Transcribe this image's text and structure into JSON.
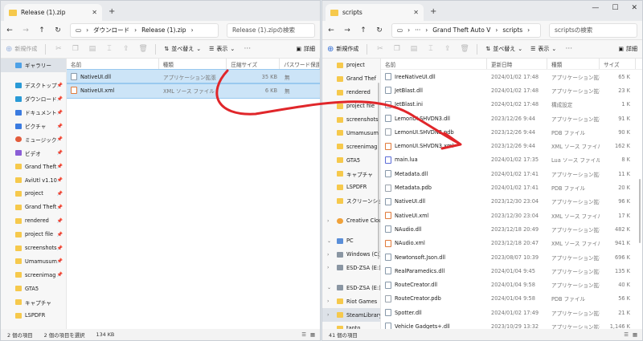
{
  "left": {
    "tab_title": "Release (1).zip",
    "path": [
      "ダウンロード",
      "Release (1).zip"
    ],
    "search_placeholder": "Release (1).zipの検索",
    "new_label": "新規作成",
    "sort_label": "並べ替え",
    "view_label": "表示",
    "details_label": "詳細",
    "sidebar": [
      {
        "label": "ギャラリー",
        "icon": "gallery-icon",
        "pinned": false,
        "selected": true,
        "gap_after": true
      },
      {
        "label": "デスクトップ",
        "icon": "desktop-icon",
        "pinned": true
      },
      {
        "label": "ダウンロード",
        "icon": "download-icon",
        "pinned": true
      },
      {
        "label": "ドキュメント",
        "icon": "document-icon",
        "pinned": true
      },
      {
        "label": "ピクチャ",
        "icon": "picture-icon",
        "pinned": true
      },
      {
        "label": "ミュージック",
        "icon": "music-icon",
        "pinned": true
      },
      {
        "label": "ビデオ",
        "icon": "video-icon",
        "pinned": true
      },
      {
        "label": "Grand Theft",
        "icon": "folder-icon",
        "pinned": true
      },
      {
        "label": "AviUtl v1.10",
        "icon": "folder-icon",
        "pinned": true
      },
      {
        "label": "project",
        "icon": "folder-icon",
        "pinned": true
      },
      {
        "label": "Grand Theft",
        "icon": "folder-icon",
        "pinned": true
      },
      {
        "label": "rendered",
        "icon": "folder-icon",
        "pinned": true
      },
      {
        "label": "project file",
        "icon": "folder-icon",
        "pinned": true
      },
      {
        "label": "screenshots",
        "icon": "folder-icon",
        "pinned": true
      },
      {
        "label": "Umamusum",
        "icon": "folder-icon",
        "pinned": true
      },
      {
        "label": "screenimag",
        "icon": "folder-icon",
        "pinned": true
      },
      {
        "label": "GTA5",
        "icon": "folder-icon",
        "pinned": false
      },
      {
        "label": "キャプチャ",
        "icon": "folder-icon",
        "pinned": false
      },
      {
        "label": "LSPDFR",
        "icon": "folder-icon",
        "pinned": false
      }
    ],
    "columns": [
      "名前",
      "種類",
      "圧縮サイズ",
      "パスワード保護"
    ],
    "files": [
      {
        "name": "NativeUI.dll",
        "type": "アプリケーション拡張",
        "size": "35 KB",
        "password": "無",
        "icon": "dll"
      },
      {
        "name": "NativeUI.xml",
        "type": "XML ソース ファイル",
        "size": "6 KB",
        "password": "無",
        "icon": "xml"
      }
    ],
    "status": [
      "2 個の項目",
      "2 個の項目を選択",
      "134 KB"
    ]
  },
  "right": {
    "tab_title": "scripts",
    "path": [
      "Grand Theft Auto V",
      "scripts"
    ],
    "search_placeholder": "scriptsの検索",
    "new_label": "新規作成",
    "sort_label": "並べ替え",
    "view_label": "表示",
    "details_label": "詳細",
    "sidebar": [
      {
        "label": "project",
        "icon": "folder-icon"
      },
      {
        "label": "Grand Thef",
        "icon": "folder-icon"
      },
      {
        "label": "rendered",
        "icon": "folder-icon"
      },
      {
        "label": "project file",
        "icon": "folder-icon"
      },
      {
        "label": "screenshots",
        "icon": "folder-icon"
      },
      {
        "label": "Umamusum",
        "icon": "folder-icon"
      },
      {
        "label": "screenimag",
        "icon": "folder-icon"
      },
      {
        "label": "GTA5",
        "icon": "folder-icon"
      },
      {
        "label": "キャプチャ",
        "icon": "folder-icon"
      },
      {
        "label": "LSPDFR",
        "icon": "folder-icon"
      },
      {
        "label": "スクリーンショット",
        "icon": "folder-icon",
        "gap_after": true
      },
      {
        "label": "Creative Cloud",
        "icon": "cloud-icon",
        "chevron": true,
        "gap_after": true
      },
      {
        "label": "PC",
        "icon": "pc-icon",
        "chevron": true,
        "expanded": true
      },
      {
        "label": "Windows (C:)",
        "icon": "drive-icon",
        "chevron": true
      },
      {
        "label": "ESD-ZSA (E:)",
        "icon": "drive-icon",
        "chevron": true,
        "gap_after": true
      },
      {
        "label": "ESD-ZSA (E:)",
        "icon": "drive-icon",
        "chevron": true,
        "expanded": true
      },
      {
        "label": "Riot Games",
        "icon": "folder-icon",
        "chevron": true
      },
      {
        "label": "SteamLibrary",
        "icon": "folder-icon",
        "chevron": true,
        "selected": true
      },
      {
        "label": "tanto",
        "icon": "folder-icon"
      }
    ],
    "columns": [
      "名前",
      "更新日時",
      "種類",
      "サイズ"
    ],
    "files": [
      {
        "name": "IreeNativeUI.dll",
        "date": "2024/01/02 17:48",
        "type": "アプリケーション拡張",
        "size": "65 K",
        "icon": "dll"
      },
      {
        "name": "JetBlast.dll",
        "date": "2024/01/02 17:48",
        "type": "アプリケーション拡張",
        "size": "23 K",
        "icon": "dll"
      },
      {
        "name": "JetBlast.ini",
        "date": "2024/01/02 17:48",
        "type": "構成設定",
        "size": "1 K",
        "icon": "dll"
      },
      {
        "name": "LemonUI.SHVDN3.dll",
        "date": "2023/12/26 9:44",
        "type": "アプリケーション拡張",
        "size": "91 K",
        "icon": "dll"
      },
      {
        "name": "LemonUI.SHVDN3.pdb",
        "date": "2023/12/26 9:44",
        "type": "PDB ファイル",
        "size": "90 K",
        "icon": "pdb"
      },
      {
        "name": "LemonUI.SHVDN3.xml",
        "date": "2023/12/26 9:44",
        "type": "XML ソース ファイル",
        "size": "162 K",
        "icon": "xml"
      },
      {
        "name": "main.lua",
        "date": "2024/01/02 17:35",
        "type": "Lua ソース ファイル",
        "size": "8 K",
        "icon": "lua"
      },
      {
        "name": "Metadata.dll",
        "date": "2024/01/02 17:41",
        "type": "アプリケーション拡張",
        "size": "11 K",
        "icon": "dll"
      },
      {
        "name": "Metadata.pdb",
        "date": "2024/01/02 17:41",
        "type": "PDB ファイル",
        "size": "20 K",
        "icon": "pdb"
      },
      {
        "name": "NativeUI.dll",
        "date": "2023/12/30 23:04",
        "type": "アプリケーション拡張",
        "size": "96 K",
        "icon": "dll"
      },
      {
        "name": "NativeUI.xml",
        "date": "2023/12/30 23:04",
        "type": "XML ソース ファイル",
        "size": "17 K",
        "icon": "xml"
      },
      {
        "name": "NAudio.dll",
        "date": "2023/12/18 20:49",
        "type": "アプリケーション拡張",
        "size": "482 K",
        "icon": "dll"
      },
      {
        "name": "NAudio.xml",
        "date": "2023/12/18 20:47",
        "type": "XML ソース ファイル",
        "size": "941 K",
        "icon": "xml"
      },
      {
        "name": "Newtonsoft.Json.dll",
        "date": "2023/08/07 10:39",
        "type": "アプリケーション拡張",
        "size": "696 K",
        "icon": "dll"
      },
      {
        "name": "RealParamedics.dll",
        "date": "2024/01/04 9:45",
        "type": "アプリケーション拡張",
        "size": "135 K",
        "icon": "dll"
      },
      {
        "name": "RouteCreator.dll",
        "date": "2024/01/04 9:58",
        "type": "アプリケーション拡張",
        "size": "40 K",
        "icon": "dll"
      },
      {
        "name": "RouteCreator.pdb",
        "date": "2024/01/04 9:58",
        "type": "PDB ファイル",
        "size": "56 K",
        "icon": "pdb"
      },
      {
        "name": "Spotter.dll",
        "date": "2024/01/02 17:49",
        "type": "アプリケーション拡張",
        "size": "21 K",
        "icon": "dll"
      },
      {
        "name": "Vehicle Gadgets+.dll",
        "date": "2023/10/29 13:32",
        "type": "アプリケーション拡張",
        "size": "1,146 K",
        "icon": "dll"
      }
    ],
    "status": [
      "41 個の項目"
    ]
  },
  "colors": {
    "selection": "#cce4f7",
    "arrow": "#e0262a",
    "accent": "#2f6cd6"
  }
}
